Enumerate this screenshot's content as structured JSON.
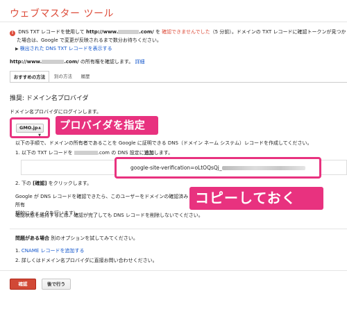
{
  "header": {
    "title": "ウェブマスター ツール"
  },
  "notice": {
    "prefix": "DNS TXT レコードを使用して",
    "url_start": "http://www.",
    "url_end": ".com/",
    "mid": "を",
    "status": "確認できませんでした",
    "elapsed": "（5 分前）",
    "rest": "。ドメインの TXT レコードに確認トークンが見つかりま",
    "line2": "た場合は、Google で変更が反映されるまで数分お待ちください。",
    "show_record_link": "検出された DNS TXT レコードを表示する"
  },
  "owner": {
    "url_start": "http://www.",
    "url_end": ".com/",
    "text": "の所有権を確認します。",
    "detail_link": "詳細"
  },
  "tabs": [
    {
      "label": "おすすめの方法"
    },
    {
      "label": "別の方法"
    },
    {
      "label": "履歴"
    }
  ],
  "section": {
    "title": "推奨: ドメイン名プロバイダ",
    "login": "ドメイン名プロバイダにログインします。",
    "provider_value": "GMO.jp",
    "callout_provider": "プロバイダを指定",
    "intro": "以下の手順で、ドメインの所有者であることを Google に証明できる DNS（ドメイン ネーム システム）レコードを作成してください。",
    "step1_prefix": "1. 以下の TXT レコードを",
    "step1_domain_suffix": ".com",
    "step1_suffix": "の DNS 設定に",
    "step1_bold": "追加",
    "step1_end": "します。",
    "txt_record": "google-site-verification=oLtOQsQj_",
    "step2_prefix": "2. 下の",
    "step2_bold": "[確認]",
    "step2_suffix": "をクリックします。",
    "para1": "Google が DNS レコードを確認できたら、このユーザーをドメインの確認済み所有",
    "para1_line2": "期的にチェックを行います）。",
    "para2": "確認状態を維持するには、確認が完了しても DNS レコードを削除しないでください。",
    "callout_copy": "コピーしておく"
  },
  "problem": {
    "bold": "問題がある場合",
    "text": "別のオプションを試してみてください。",
    "opt1_prefix": "1.",
    "opt1_link": "CNAME レコードを追加する",
    "opt2": "2. 詳しくはドメイン名プロバイダに直接お問い合わせください。"
  },
  "buttons": {
    "verify": "確認",
    "later": "後で行う"
  },
  "colors": {
    "accent_red": "#dd4b39",
    "highlight_pink": "#e8327f",
    "link_blue": "#1155cc"
  }
}
